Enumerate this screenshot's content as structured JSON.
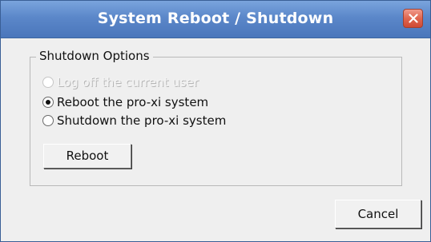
{
  "window": {
    "title": "System Reboot / Shutdown"
  },
  "shutdown_options": {
    "group_label": "Shutdown Options",
    "options": [
      {
        "label": "Log off the current user",
        "selected": false,
        "enabled": false
      },
      {
        "label": "Reboot the pro-xi system",
        "selected": true,
        "enabled": true
      },
      {
        "label": "Shutdown the pro-xi system",
        "selected": false,
        "enabled": true
      }
    ],
    "action_button": "Reboot"
  },
  "footer": {
    "cancel_label": "Cancel"
  },
  "colors": {
    "titlebar": "#5b87c9",
    "close_button": "#e0664f",
    "window_bg": "#efefef"
  },
  "icons": {
    "close": "close-icon"
  }
}
